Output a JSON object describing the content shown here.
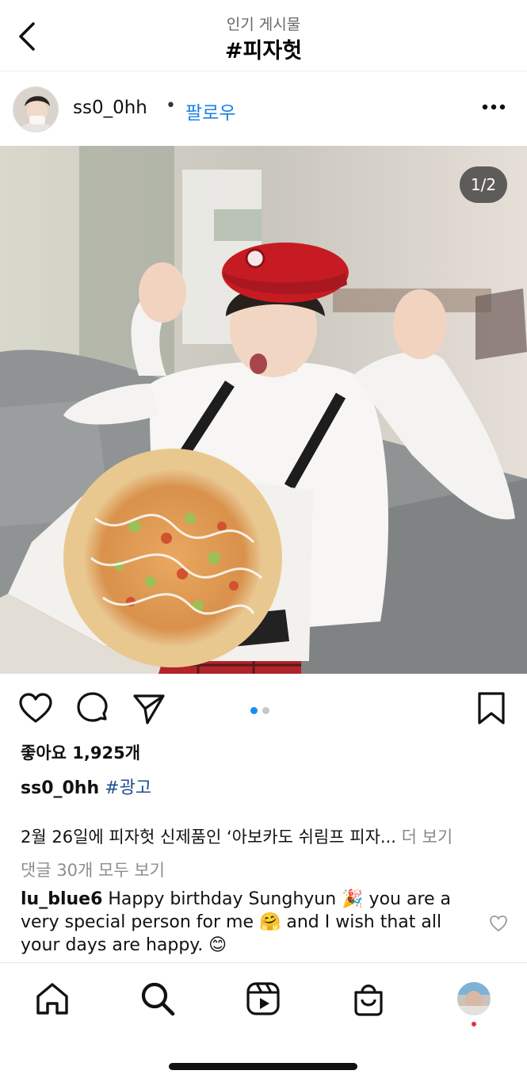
{
  "header": {
    "subtitle": "인기 게시물",
    "title": "#피자헛"
  },
  "post": {
    "username": "ss0_0hh",
    "separator": "•",
    "follow_label": "팔로우",
    "page_indicator": "1/2",
    "carousel": {
      "total": 2,
      "current": 1
    },
    "likes": "좋아요 1,925개",
    "caption_username": "ss0_0hh",
    "caption_tag": "#광고",
    "caption_text": "2월 26일에 피자헛 신제품인 ‘아보카도 쉬림프 피자...",
    "caption_more": "더 보기",
    "view_comments": "댓글 30개 모두 보기",
    "comment": {
      "username": "lu_blue6",
      "text": "Happy birthday Sunghyun 🎉 you are a very special person for me 🤗 and I wish that all your days are happy. 😊"
    }
  },
  "icons": {
    "back": "chevron-left-icon",
    "more": "more-horizontal-icon",
    "like": "heart-icon",
    "comment": "comment-icon",
    "share": "send-icon",
    "save": "bookmark-icon",
    "home": "home-icon",
    "search": "search-icon",
    "reels": "reels-icon",
    "shop": "shopping-bag-icon"
  },
  "colors": {
    "link_blue": "#1a80e6",
    "hashtag_blue": "#1d4f8c",
    "carousel_active": "#1a8cf0",
    "carousel_inactive": "#c7c7c7",
    "notification_dot": "#e0323c"
  }
}
